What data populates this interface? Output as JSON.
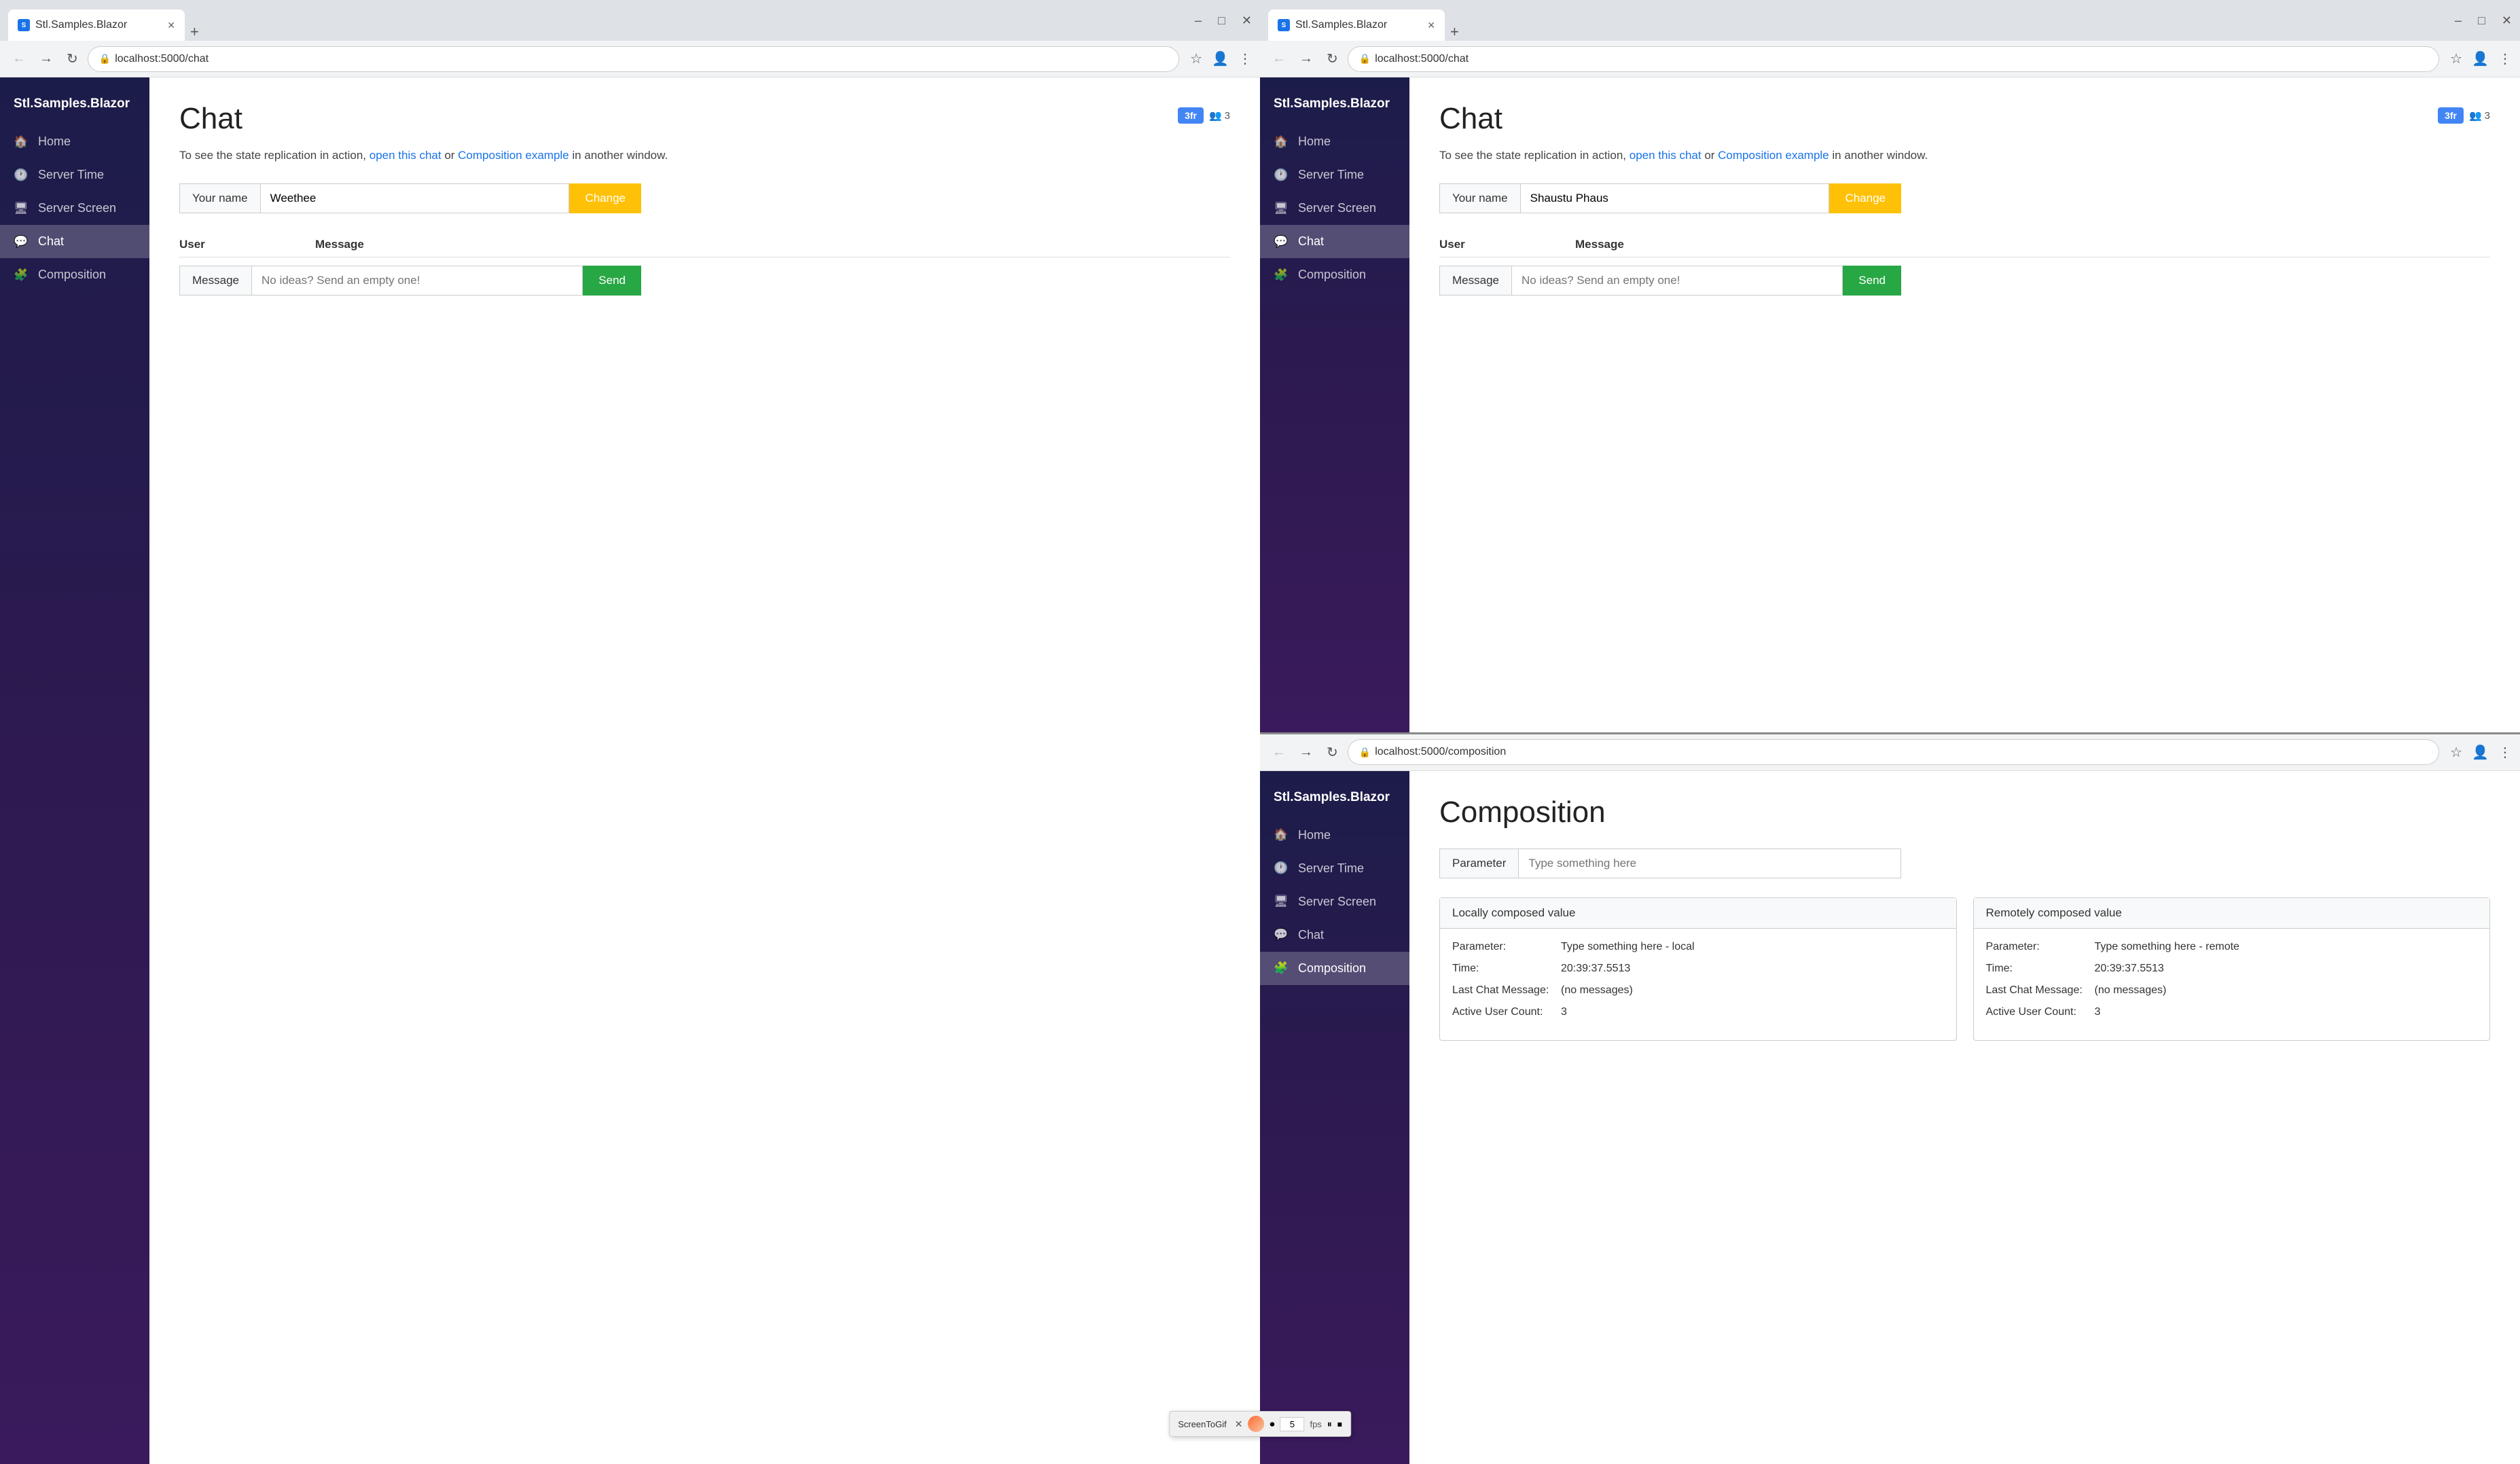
{
  "app": {
    "brand": "Stl.Samples.Blazor",
    "tab_title": "Stl.Samples.Blazor",
    "favicon_letter": "S"
  },
  "browser_left": {
    "tab_title": "Stl.Samples.Blazor",
    "url": "localhost:5000/chat",
    "nav": {
      "items": [
        {
          "label": "Home",
          "icon": "🏠",
          "active": false
        },
        {
          "label": "Server Time",
          "icon": "🕐",
          "active": false
        },
        {
          "label": "Server Screen",
          "icon": "🖥",
          "active": false
        },
        {
          "label": "Chat",
          "icon": "💬",
          "active": true
        },
        {
          "label": "Composition",
          "icon": "🧩",
          "active": false
        }
      ]
    },
    "chat": {
      "title": "Chat",
      "badge_label": "3fr",
      "user_count": "3",
      "description_pre": "To see the state replication in action, ",
      "link1": "open this chat",
      "description_mid": " or ",
      "link2": "Composition example",
      "description_post": " in another window.",
      "your_name_label": "Your name",
      "your_name_value": "Weethee",
      "change_btn": "Change",
      "user_col": "User",
      "message_col": "Message",
      "message_label": "Message",
      "message_placeholder": "No ideas? Send an empty one!",
      "send_btn": "Send"
    }
  },
  "browser_right_top": {
    "tab_title": "Stl.Samples.Blazor",
    "url": "localhost:5000/chat",
    "nav": {
      "items": [
        {
          "label": "Home",
          "icon": "🏠",
          "active": false
        },
        {
          "label": "Server Time",
          "icon": "🕐",
          "active": false
        },
        {
          "label": "Server Screen",
          "icon": "🖥",
          "active": false
        },
        {
          "label": "Chat",
          "icon": "💬",
          "active": true
        },
        {
          "label": "Composition",
          "icon": "🧩",
          "active": false
        }
      ]
    },
    "chat": {
      "title": "Chat",
      "badge_label": "3fr",
      "user_count": "3",
      "description_pre": "To see the state replication in action, ",
      "link1": "open this chat",
      "description_mid": " or ",
      "link2": "Composition example",
      "description_post": " in another window.",
      "your_name_label": "Your name",
      "your_name_value": "Shaustu Phaus",
      "change_btn": "Change",
      "user_col": "User",
      "message_col": "Message",
      "message_label": "Message",
      "message_placeholder": "No ideas? Send an empty one!",
      "send_btn": "Send"
    }
  },
  "browser_right_bottom": {
    "tab_title": "Stl.Samples.Blazor",
    "url": "localhost:5000/composition",
    "nav": {
      "items": [
        {
          "label": "Home",
          "icon": "🏠",
          "active": false
        },
        {
          "label": "Server Time",
          "icon": "🕐",
          "active": false
        },
        {
          "label": "Server Screen",
          "icon": "🖥",
          "active": false
        },
        {
          "label": "Chat",
          "icon": "💬",
          "active": false
        },
        {
          "label": "Composition",
          "icon": "🧩",
          "active": true
        }
      ]
    },
    "composition": {
      "title": "Composition",
      "parameter_label": "Parameter",
      "parameter_placeholder": "Type something here",
      "local_panel": {
        "title": "Locally composed value",
        "parameter_key": "Parameter:",
        "parameter_val": "Type something here - local",
        "time_key": "Time:",
        "time_val": "20:39:37.5513",
        "last_chat_key": "Last Chat Message:",
        "last_chat_val": "(no messages)",
        "active_user_key": "Active User Count:",
        "active_user_val": "3"
      },
      "remote_panel": {
        "title": "Remotely composed value",
        "parameter_key": "Parameter:",
        "parameter_val": "Type something here - remote",
        "time_key": "Time:",
        "time_val": "20:39:37.5513",
        "last_chat_key": "Last Chat Message:",
        "last_chat_val": "(no messages)",
        "active_user_key": "Active User Count:",
        "active_user_val": "3"
      }
    }
  },
  "screentogif": {
    "title": "ScreenToGif",
    "fps_value": "5",
    "fps_label": "fps"
  }
}
